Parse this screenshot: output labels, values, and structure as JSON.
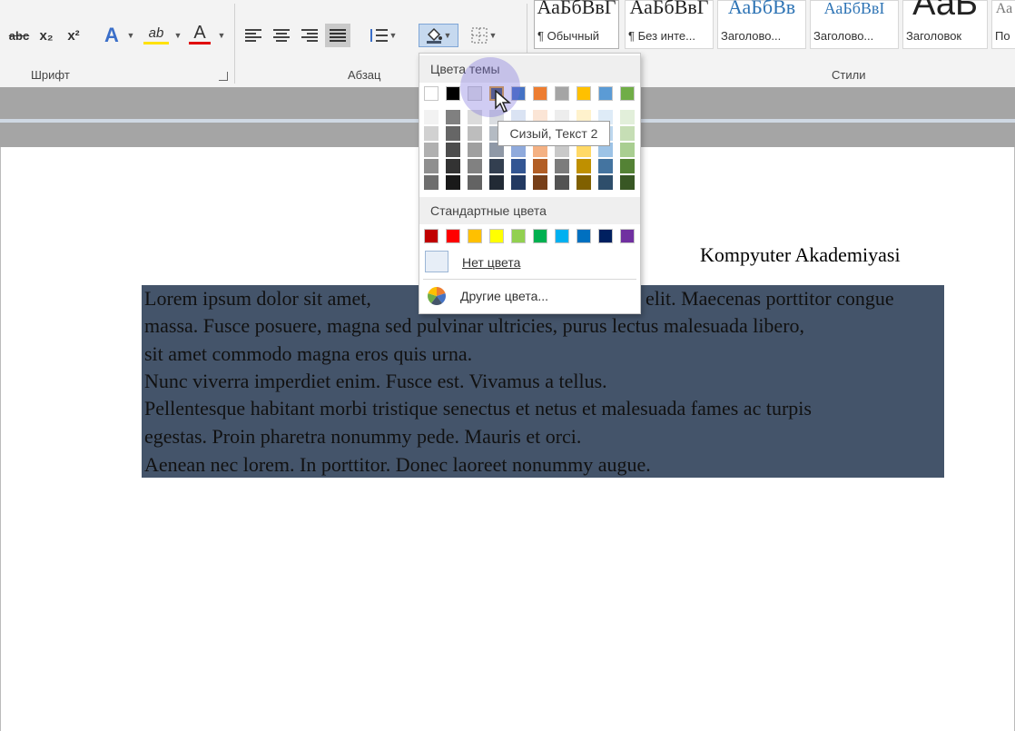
{
  "ribbon": {
    "groups": {
      "font": "Шрифт",
      "paragraph": "Абзац",
      "styles": "Стили"
    },
    "font_buttons": {
      "strikethrough": "abc",
      "subscript": "x₂",
      "superscript": "x²",
      "text_effects": "A",
      "highlight": "ab",
      "font_color": "A"
    },
    "styles": [
      {
        "sample": "АаБбВвГ",
        "name": "¶ Обычный"
      },
      {
        "sample": "АаБбВвГ",
        "name": "¶ Без инте..."
      },
      {
        "sample": "АаБбВв",
        "name": "Заголово..."
      },
      {
        "sample": "АаБбВвІ",
        "name": "Заголово..."
      },
      {
        "sample": "АаБ",
        "name": "Заголовок"
      },
      {
        "sample": "Аа",
        "name": "По"
      }
    ]
  },
  "colors": {
    "accent": "#44546a",
    "theme_row": [
      "#ffffff",
      "#000000",
      "#e7e6e6",
      "#44546a",
      "#4472c4",
      "#ed7d31",
      "#a5a5a5",
      "#ffc000",
      "#5b9bd5",
      "#70ad47"
    ],
    "standard_row": [
      "#c00000",
      "#ff0000",
      "#ffc000",
      "#ffff00",
      "#92d050",
      "#00b050",
      "#00b0f0",
      "#0070c0",
      "#002060",
      "#7030a0"
    ]
  },
  "dropdown": {
    "theme_colors_header": "Цвета темы",
    "standard_colors_header": "Стандартные цвета",
    "no_color": "Нет цвета",
    "more_colors": "Другие цвета...",
    "tooltip": "Сизый, Текст 2"
  },
  "document": {
    "title": "Kompyuter Akademiyasi",
    "lines": [
      "Lorem ipsum dolor sit amet,",
      "elit. Maecenas porttitor congue",
      "massa. Fusce posuere, magna sed pulvinar ultricies, purus lectus malesuada libero,",
      "sit amet commodo magna eros quis urna.",
      "Nunc viverra imperdiet enim. Fusce est. Vivamus a tellus.",
      "Pellentesque habitant morbi tristique senectus et netus et malesuada fames ac turpis",
      "egestas. Proin pharetra nonummy pede. Mauris et orci.",
      "Aenean nec lorem. In porttitor. Donec laoreet nonummy augue."
    ]
  }
}
